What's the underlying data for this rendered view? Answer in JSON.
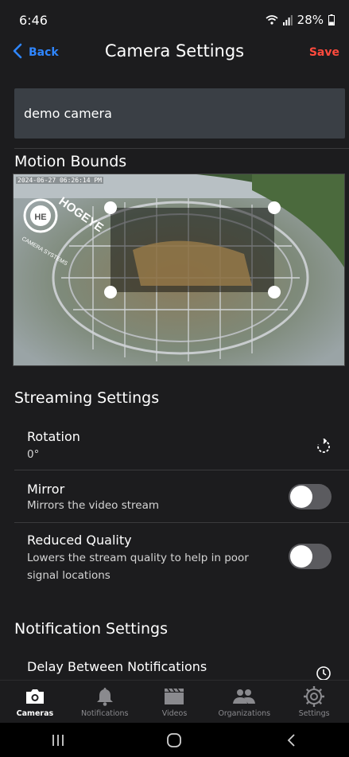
{
  "status": {
    "time": "6:46",
    "battery": "28%"
  },
  "header": {
    "back_label": "Back",
    "title": "Camera Settings",
    "save_label": "Save"
  },
  "camera_name": "demo camera",
  "motion": {
    "title": "Motion Bounds",
    "timestamp": "2024-06-27  06:26:14 PM",
    "logo_text": "HOGEYE",
    "logo_subtext": "CAMERA SYSTEMS"
  },
  "streaming": {
    "title": "Streaming Settings",
    "rotation": {
      "label": "Rotation",
      "value": "0°"
    },
    "mirror": {
      "label": "Mirror",
      "description": "Mirrors the video stream",
      "enabled": false
    },
    "reduced_quality": {
      "label": "Reduced Quality",
      "description_line1": "Lowers the stream quality to help in poor",
      "description_line2": "signal locations",
      "enabled": false
    }
  },
  "notifications": {
    "title": "Notification Settings",
    "delay_label": "Delay Between Notifications"
  },
  "nav": {
    "items": [
      {
        "label": "Cameras",
        "icon": "camera-icon",
        "active": true
      },
      {
        "label": "Notifications",
        "icon": "bell-icon",
        "active": false
      },
      {
        "label": "Videos",
        "icon": "clapperboard-icon",
        "active": false
      },
      {
        "label": "Organizations",
        "icon": "people-icon",
        "active": false
      },
      {
        "label": "Settings",
        "icon": "gear-icon",
        "active": false
      }
    ]
  },
  "colors": {
    "accent_blue": "#2f86ff",
    "save_red": "#ff4a3d",
    "background": "#1c1c1e"
  }
}
